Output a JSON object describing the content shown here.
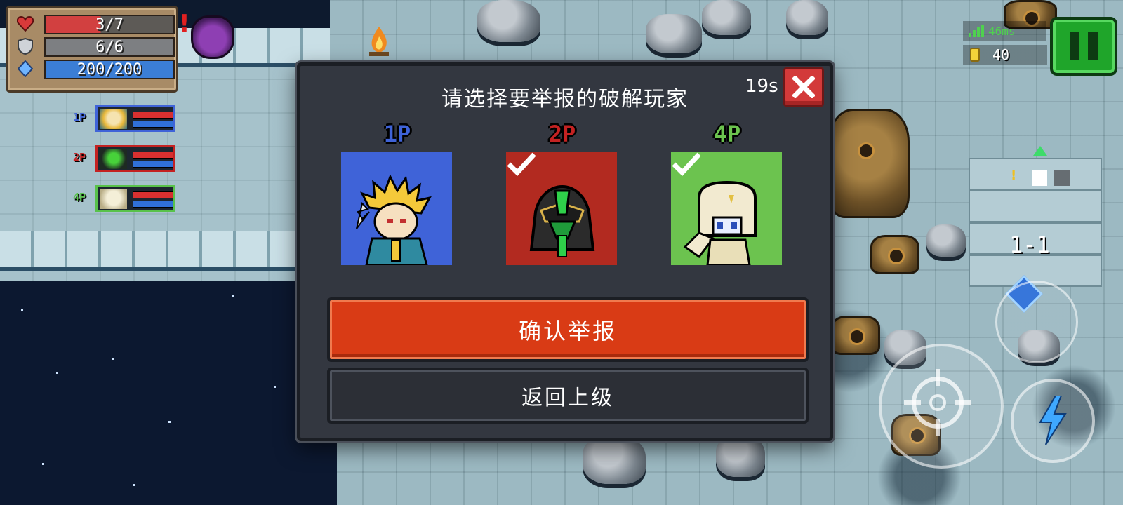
{
  "hud": {
    "health": "3/7",
    "armor": "6/6",
    "energy": "200/200",
    "ping": "46ms",
    "coins": "40",
    "level": "1-1"
  },
  "team": [
    {
      "tag": "1P",
      "color": "#3f63d8"
    },
    {
      "tag": "2P",
      "color": "#c42222"
    },
    {
      "tag": "4P",
      "color": "#58c24a"
    }
  ],
  "dialog": {
    "title": "请选择要举报的破解玩家",
    "timer": "19s",
    "players": [
      {
        "tag": "1P",
        "color": "#3f63d8",
        "checked": false
      },
      {
        "tag": "2P",
        "color": "#c42222",
        "checked": true
      },
      {
        "tag": "4P",
        "color": "#6cc34f",
        "checked": true
      }
    ],
    "confirm_label": "确认举报",
    "back_label": "返回上级"
  }
}
